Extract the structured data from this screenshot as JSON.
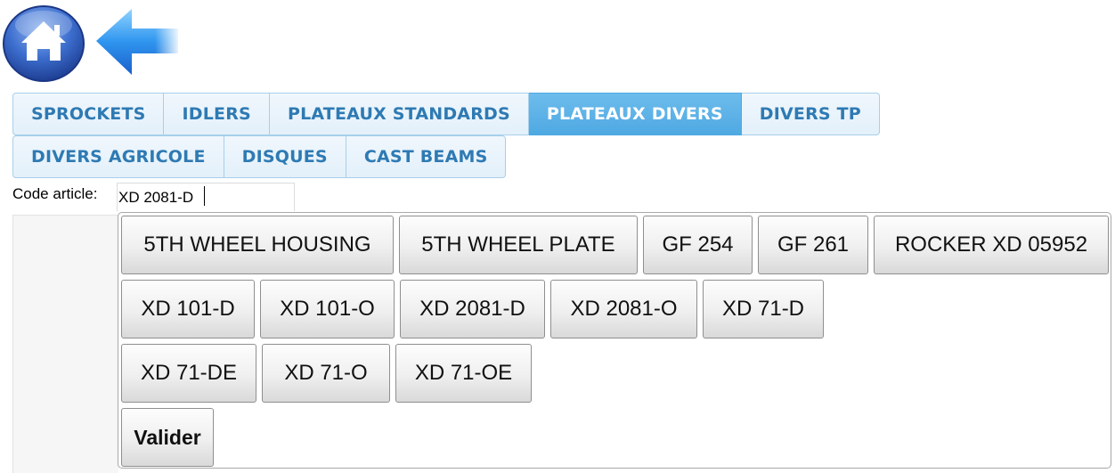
{
  "nav": {
    "home_icon": "home-icon",
    "back_icon": "back-arrow-icon"
  },
  "tabs": {
    "row1": [
      "SPROCKETS",
      "IDLERS",
      "PLATEAUX STANDARDS",
      "PLATEAUX DIVERS",
      "DIVERS TP"
    ],
    "row2": [
      "DIVERS AGRICOLE",
      "DISQUES",
      "CAST BEAMS"
    ],
    "active": "PLATEAUX DIVERS"
  },
  "form": {
    "code_label": "Code article:",
    "code_value": "XD 2081-D"
  },
  "keys": {
    "row1": [
      "5TH WHEEL HOUSING",
      "5TH WHEEL PLATE",
      "GF 254",
      "GF 261",
      "ROCKER XD 05952"
    ],
    "row2": [
      "XD 101-D",
      "XD 101-O",
      "XD 2081-D",
      "XD 2081-O",
      "XD 71-D"
    ],
    "row3": [
      "XD 71-DE",
      "XD 71-O",
      "XD 71-OE"
    ],
    "validate": "Valider"
  },
  "colors": {
    "tab_text": "#2e7ab3",
    "tab_active_bg": "#56ade4",
    "icon_blue": "#2f6fd3"
  }
}
